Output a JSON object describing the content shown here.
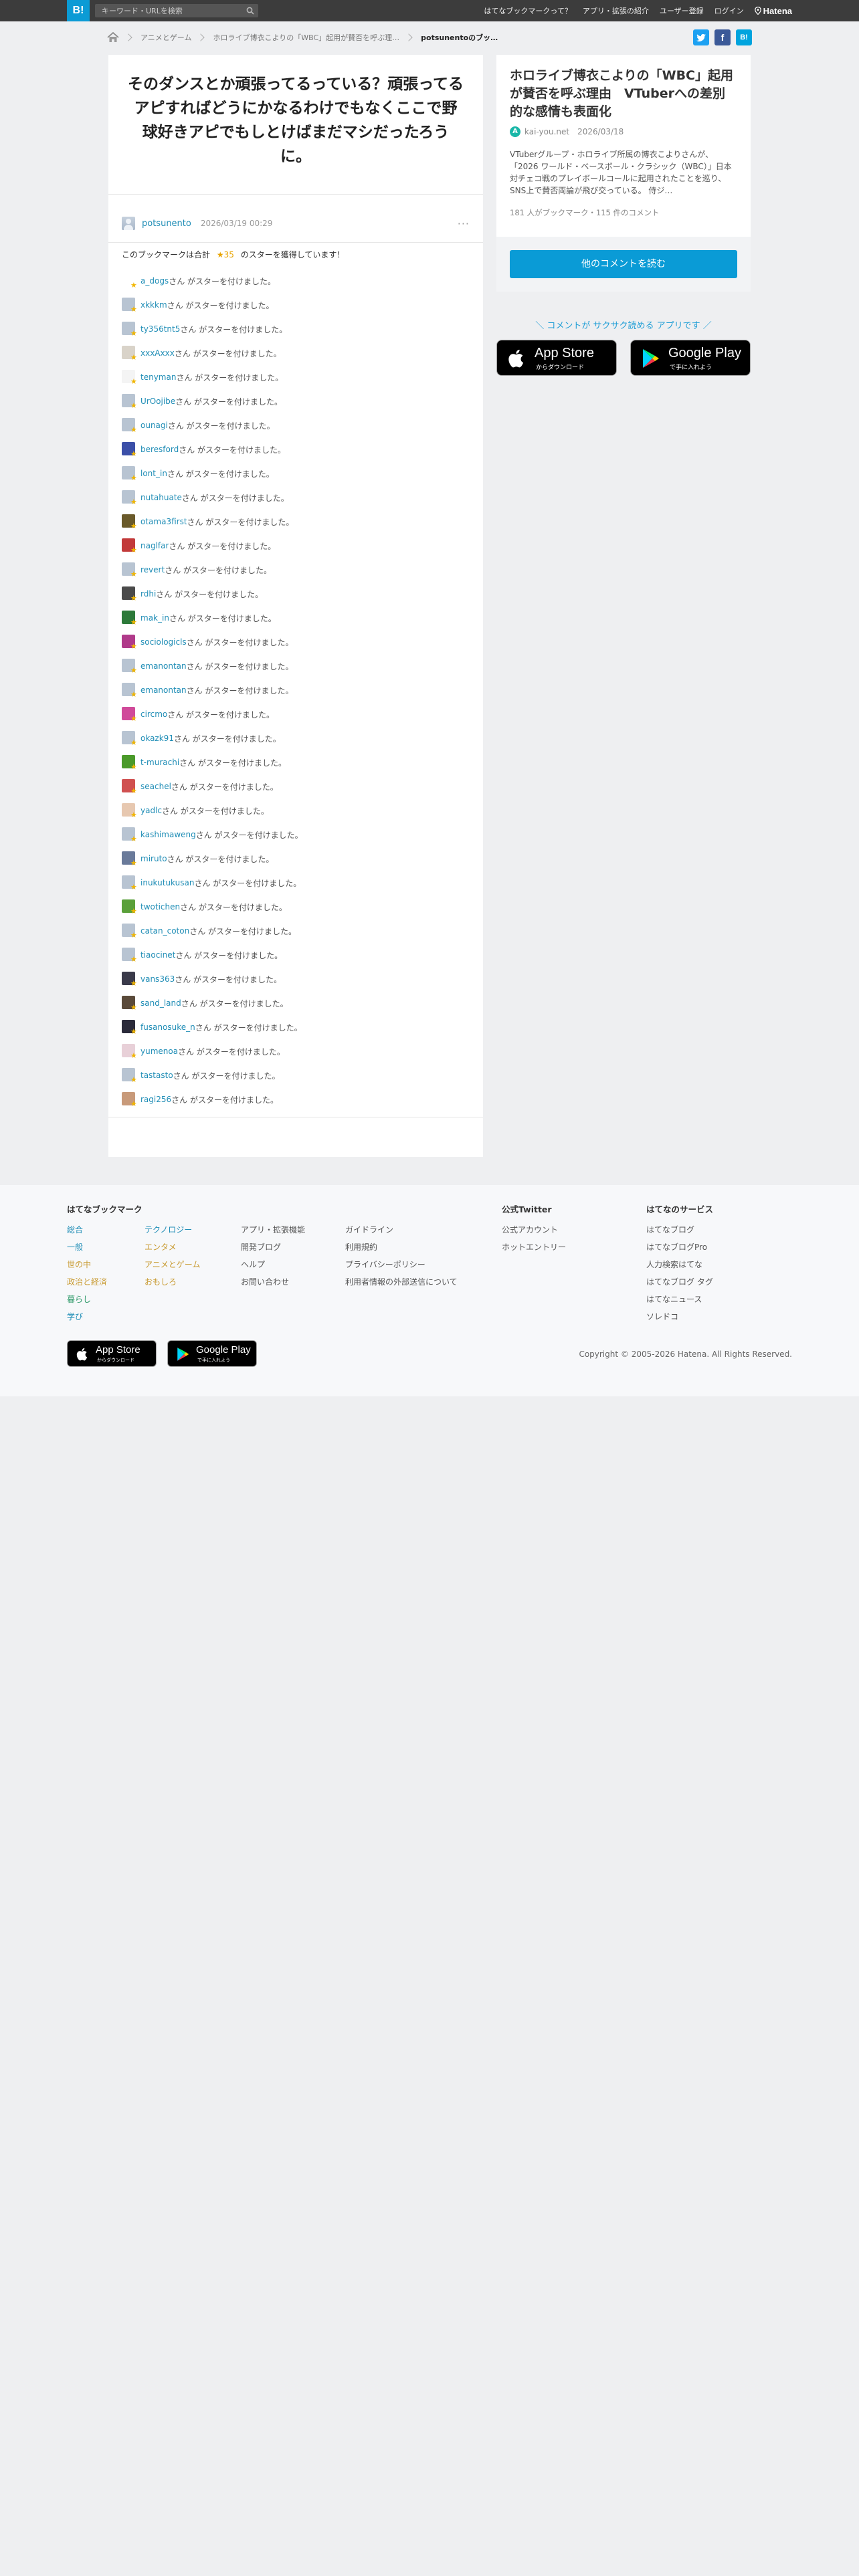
{
  "header": {
    "logo": "B!",
    "search_placeholder": "キーワード・URLを検索",
    "links": [
      "はてなブックマークって？",
      "アプリ・拡張の紹介",
      "ユーザー登録",
      "ログイン"
    ],
    "brand": "Hatena"
  },
  "breadcrumb": {
    "items": [
      "アニメとゲーム",
      "ホロライブ博衣こよりの「WBC」起用が賛否を呼ぶ理…",
      "potsunentoのブッ…"
    ]
  },
  "share": {
    "twitter": "t",
    "facebook": "f",
    "hatena": "B!"
  },
  "entry": {
    "comment": "そのダンスとか頑張ってるっている？頑張ってるアピすればどうにかなるわけでもなくここで野球好きアピでもしとけばまだマシだったろうに。",
    "user": "potsunento",
    "date": "2026/03/19 00:29",
    "more": "···"
  },
  "stars": {
    "prefix": "このブックマークは合計",
    "count": "★35",
    "suffix": "のスターを獲得しています！",
    "row_suffix": "さん がスターを付けました。",
    "users": [
      {
        "name": "a_dogs",
        "color": "#ffffff"
      },
      {
        "name": "xkkkm",
        "color": "#b8c4d2"
      },
      {
        "name": "ty356tnt5",
        "color": "#b8c4d2"
      },
      {
        "name": "xxxAxxx",
        "color": "#d9d3c9"
      },
      {
        "name": "tenyman",
        "color": "#f4f4f4"
      },
      {
        "name": "UrOojibe",
        "color": "#b8c4d2"
      },
      {
        "name": "ounagi",
        "color": "#b8c4d2"
      },
      {
        "name": "beresford",
        "color": "#3b4fa8"
      },
      {
        "name": "lont_in",
        "color": "#b8c4d2"
      },
      {
        "name": "nutahuate",
        "color": "#b8c4d2"
      },
      {
        "name": "otama3first",
        "color": "#6a5a2a"
      },
      {
        "name": "naglfar",
        "color": "#c23a3a"
      },
      {
        "name": "revert",
        "color": "#b8c4d2"
      },
      {
        "name": "rdhi",
        "color": "#4a4a4a"
      },
      {
        "name": "mak_in",
        "color": "#2d7a3a"
      },
      {
        "name": "sociologicls",
        "color": "#b03a8a"
      },
      {
        "name": "emanontan",
        "color": "#b8c4d2"
      },
      {
        "name": "emanontan",
        "color": "#b8c4d2"
      },
      {
        "name": "circmo",
        "color": "#d04a9a"
      },
      {
        "name": "okazk91",
        "color": "#b8c4d2"
      },
      {
        "name": "t-murachi",
        "color": "#4a9a2a"
      },
      {
        "name": "seachel",
        "color": "#d05050"
      },
      {
        "name": "yadlc",
        "color": "#e7c8b0"
      },
      {
        "name": "kashimaweng",
        "color": "#b8c4d2"
      },
      {
        "name": "miruto",
        "color": "#6a7a9a"
      },
      {
        "name": "inukutukusan",
        "color": "#b8c4d2"
      },
      {
        "name": "twotichen",
        "color": "#5aa03a"
      },
      {
        "name": "catan_coton",
        "color": "#b8c4d2"
      },
      {
        "name": "tiaocinet",
        "color": "#b8c4d2"
      },
      {
        "name": "vans363",
        "color": "#3a3a4a"
      },
      {
        "name": "sand_land",
        "color": "#5a4a3a"
      },
      {
        "name": "fusanosuke_n",
        "color": "#2a2a3a"
      },
      {
        "name": "yumenoa",
        "color": "#e8d0d8"
      },
      {
        "name": "tastasto",
        "color": "#b8c4d2"
      },
      {
        "name": "ragi256",
        "color": "#c89a7a"
      }
    ]
  },
  "related": {
    "title": "ホロライブ博衣こよりの「WBC」起用が賛否を呼ぶ理由　VTuberへの差別的な感情も表面化",
    "favicon": "A",
    "domain": "kai-you.net",
    "date": "2026/03/18",
    "description": "VTuberグループ・ホロライブ所属の博衣こよりさんが、「2026 ワールド・ベースボール・クラシック（WBC）」日本対チェコ戦のプレイボールコールに起用されたことを巡り、SNS上で賛否両論が飛び交っている。 侍ジ…",
    "meta": "181 人がブックマーク・115 件のコメント",
    "button": "他のコメントを読む"
  },
  "promo": {
    "text": "＼ コメントが サクサク読める アプリです ／"
  },
  "app_store": {
    "big": "App Store",
    "small": "からダウンロード"
  },
  "google_play": {
    "big": "Google Play",
    "small": "で手に入れよう"
  },
  "footer": {
    "col1_title": "はてなブックマーク",
    "col1a": [
      {
        "label": "総合",
        "color": "#1f8db6"
      },
      {
        "label": "一般",
        "color": "#1f8db6"
      },
      {
        "label": "世の中",
        "color": "#c89a30"
      },
      {
        "label": "政治と経済",
        "color": "#c89a30"
      },
      {
        "label": "暮らし",
        "color": "#2f9a6a"
      },
      {
        "label": "学び",
        "color": "#1f8db6"
      }
    ],
    "col1b": [
      {
        "label": "テクノロジー",
        "color": "#1f8db6"
      },
      {
        "label": "エンタメ",
        "color": "#c89a30"
      },
      {
        "label": "アニメとゲーム",
        "color": "#c89a30"
      },
      {
        "label": "おもしろ",
        "color": "#c89a30"
      }
    ],
    "col2": [
      "アプリ・拡張機能",
      "開発ブログ",
      "ヘルプ",
      "お問い合わせ"
    ],
    "col3": [
      "ガイドライン",
      "利用規約",
      "プライバシーポリシー",
      "利用者情報の外部送信について"
    ],
    "col4_title": "公式Twitter",
    "col4": [
      "公式アカウント",
      "ホットエントリー"
    ],
    "col5_title": "はてなのサービス",
    "col5": [
      "はてなブログ",
      "はてなブログPro",
      "人力検索はてな",
      "はてなブログ タグ",
      "はてなニュース",
      "ソレドコ"
    ],
    "copyright": "Copyright © 2005-2026 Hatena. All Rights Reserved."
  }
}
